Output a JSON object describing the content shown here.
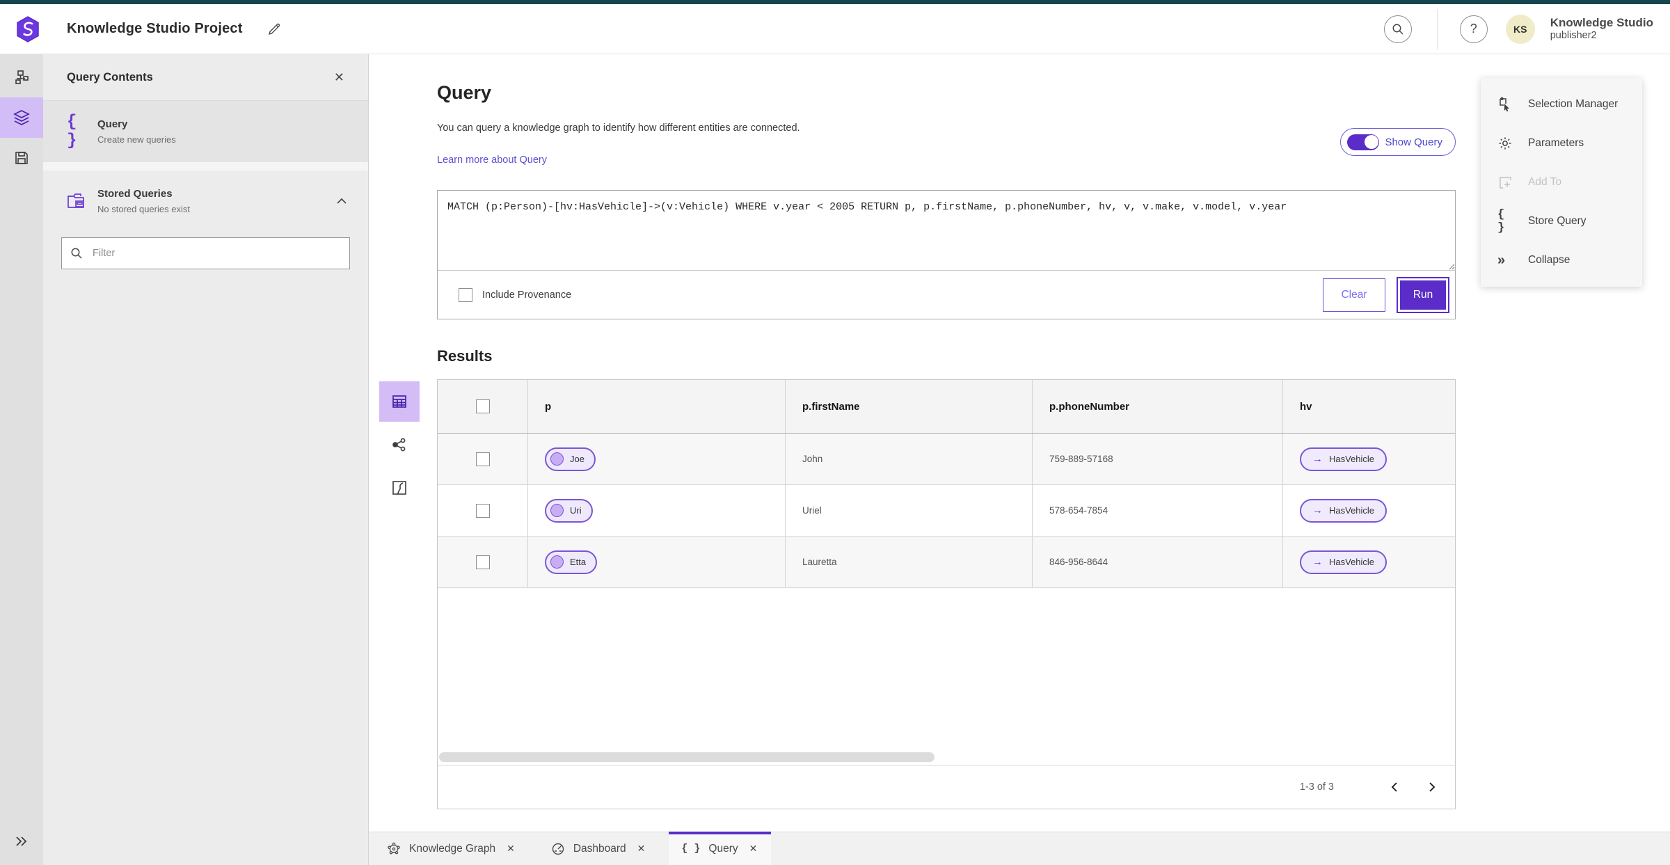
{
  "header": {
    "app_title": "Knowledge Studio Project",
    "user_name": "Knowledge Studio",
    "user_role": "publisher2",
    "avatar_initials": "KS",
    "help_glyph": "?"
  },
  "left_panel": {
    "title": "Query Contents",
    "query_item": {
      "label": "Query",
      "sublabel": "Create new queries"
    },
    "stored_item": {
      "label": "Stored Queries",
      "sublabel": "No stored queries exist"
    },
    "filter_placeholder": "Filter"
  },
  "query_section": {
    "title": "Query",
    "description": "You can query a knowledge graph to identify how different entities are connected.",
    "link": "Learn more about Query",
    "show_query_label": "Show Query",
    "query_text": "MATCH (p:Person)-[hv:HasVehicle]->(v:Vehicle) WHERE v.year < 2005 RETURN p, p.firstName, p.phoneNumber, hv, v, v.make, v.model, v.year",
    "include_provenance_label": "Include Provenance",
    "clear_label": "Clear",
    "run_label": "Run"
  },
  "results": {
    "title": "Results",
    "columns": [
      "p",
      "p.firstName",
      "p.phoneNumber",
      "hv"
    ],
    "rows": [
      {
        "p": "Joe",
        "firstName": "John",
        "phoneNumber": "759-889-57168",
        "hv": "HasVehicle",
        "hv_arrow": "→"
      },
      {
        "p": "Uri",
        "firstName": "Uriel",
        "phoneNumber": "578-654-7854",
        "hv": "HasVehicle",
        "hv_arrow": "→"
      },
      {
        "p": "Etta",
        "firstName": "Lauretta",
        "phoneNumber": "846-956-8644",
        "hv": "HasVehicle",
        "hv_arrow": "→"
      }
    ],
    "pagination": "1-3 of 3"
  },
  "right_panel": {
    "items": [
      {
        "label": "Selection Manager"
      },
      {
        "label": "Parameters"
      },
      {
        "label": "Add To"
      },
      {
        "label": "Store Query"
      },
      {
        "label": "Collapse"
      }
    ]
  },
  "tabs": [
    {
      "label": "Knowledge Graph"
    },
    {
      "label": "Dashboard"
    },
    {
      "label": "Query"
    }
  ],
  "glyphs": {
    "braces": "{ }",
    "close": "✕",
    "collapse": "»"
  },
  "colors": {
    "accent": "#5b2cc8",
    "accent_light": "#d3bdf6",
    "topstrip": "#17454e",
    "link": "#5a50d2"
  }
}
